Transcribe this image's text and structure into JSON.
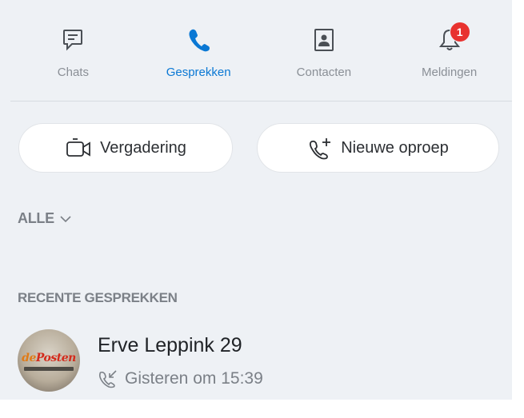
{
  "nav": {
    "items": [
      {
        "label": "Chats",
        "icon": "chat-icon",
        "active": false
      },
      {
        "label": "Gesprekken",
        "icon": "phone-icon",
        "active": true
      },
      {
        "label": "Contacten",
        "icon": "contacts-icon",
        "active": false
      },
      {
        "label": "Meldingen",
        "icon": "bell-icon",
        "active": false,
        "badge": "1"
      }
    ]
  },
  "actions": {
    "meeting_label": "Vergadering",
    "meeting_icon": "video-icon",
    "new_call_label": "Nieuwe oproep",
    "new_call_icon": "add-call-icon"
  },
  "filter": {
    "label": "ALLE",
    "icon": "chevron-down-icon"
  },
  "recent": {
    "title": "RECENTE GESPREKKEN",
    "items": [
      {
        "name": "Erve Leppink 29",
        "time": "Gisteren om 15:39",
        "call_icon": "incoming-call-icon",
        "avatar_text_a": "de",
        "avatar_text_b": "Posten"
      }
    ]
  },
  "colors": {
    "accent": "#0a78d4",
    "badge": "#e8322f",
    "background": "#eef1f5",
    "muted_text": "#7b8087"
  }
}
